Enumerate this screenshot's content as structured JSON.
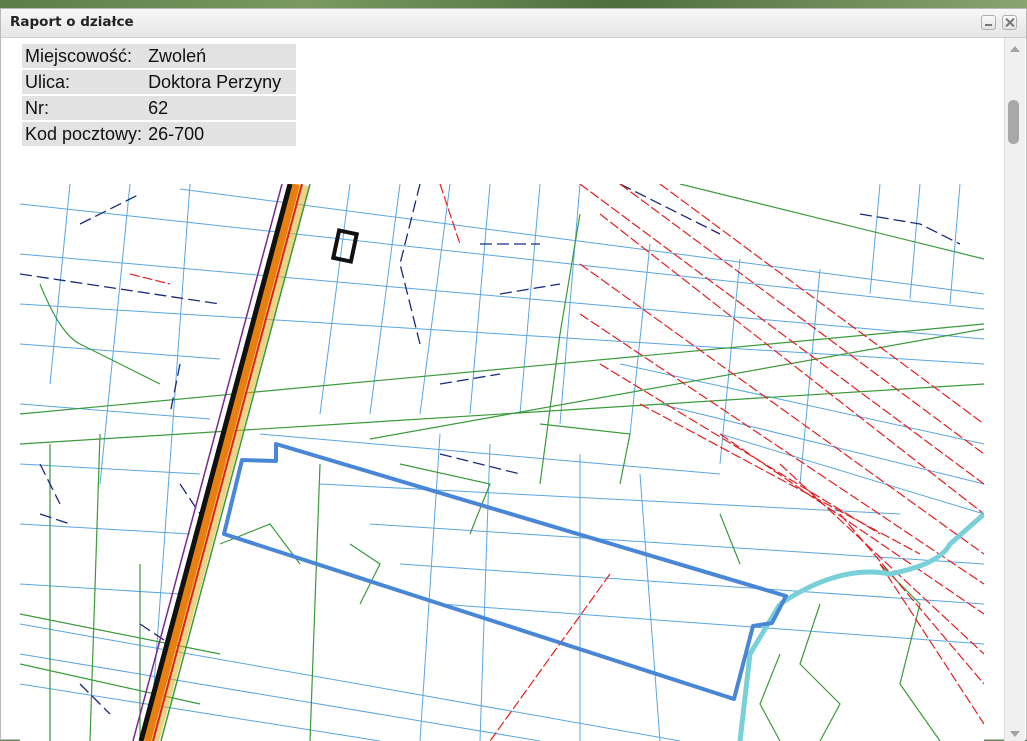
{
  "window": {
    "title": "Raport o działce",
    "buttons": {
      "minimize": "minimize-icon",
      "close": "close-icon"
    }
  },
  "info_table": {
    "rows": [
      {
        "label": "Miejscowość:",
        "value": "Zwoleń"
      },
      {
        "label": "Ulica:",
        "value": "Doktora Perzyny"
      },
      {
        "label": "Nr:",
        "value": "62"
      },
      {
        "label": "Kod pocztowy:",
        "value": "26-700"
      }
    ]
  },
  "map": {
    "colors": {
      "parcel_outline": "#4a86d6",
      "parcel_lines": "#5aa6e0",
      "network_green": "#3a9a3a",
      "network_dark_blue": "#1a2a7a",
      "network_red": "#e02020",
      "road_black": "#111111",
      "road_orange": "#e88010",
      "road_yellow": "#d8b020",
      "river": "#7ad0d8"
    }
  },
  "scrollbar": {
    "position": 0.1
  }
}
